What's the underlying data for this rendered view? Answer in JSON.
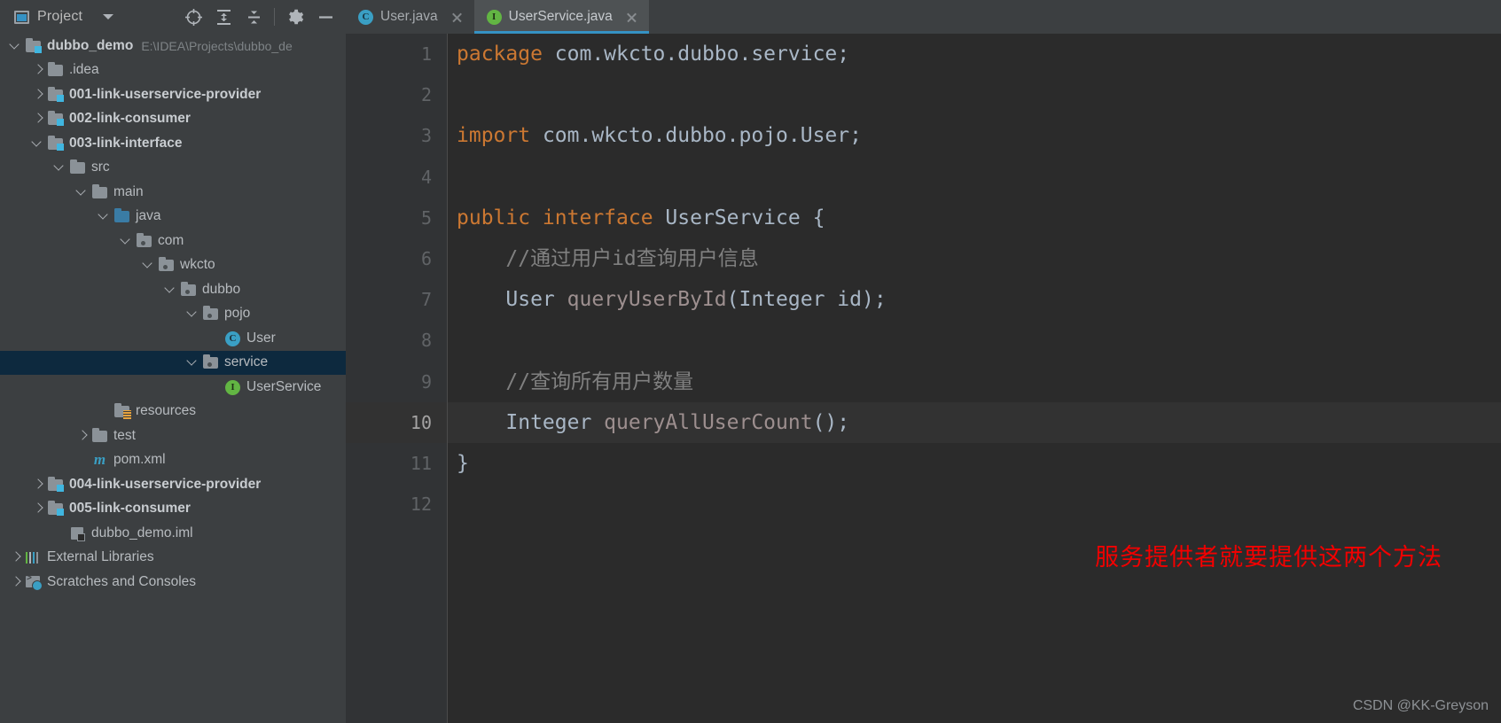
{
  "project_panel": {
    "title": "Project",
    "window_icon": "project-window-icon",
    "dropdown_icon": "chevron-down-icon",
    "toolbar_buttons": [
      {
        "name": "locate-icon",
        "label": "",
        "glyph": "crosshair"
      },
      {
        "name": "expand-all-icon",
        "label": "",
        "glyph": "expand-all"
      },
      {
        "name": "collapse-all-icon",
        "label": "",
        "glyph": "collapse-all"
      },
      {
        "name": "settings-gear-icon",
        "label": "",
        "glyph": "gear"
      },
      {
        "name": "hide-panel-icon",
        "label": "",
        "glyph": "minus"
      }
    ]
  },
  "tree": [
    {
      "indent": 0,
      "arrow": "down",
      "icon": "module-folder",
      "label": "dubbo_demo",
      "bold": true,
      "path": "E:\\IDEA\\Projects\\dubbo_de",
      "selected": false
    },
    {
      "indent": 1,
      "arrow": "right",
      "icon": "folder",
      "label": ".idea",
      "bold": false,
      "selected": false
    },
    {
      "indent": 1,
      "arrow": "right",
      "icon": "module-folder",
      "label": "001-link-userservice-provider",
      "bold": true,
      "selected": false
    },
    {
      "indent": 1,
      "arrow": "right",
      "icon": "module-folder",
      "label": "002-link-consumer",
      "bold": true,
      "selected": false
    },
    {
      "indent": 1,
      "arrow": "down",
      "icon": "module-folder",
      "label": "003-link-interface",
      "bold": true,
      "selected": false
    },
    {
      "indent": 2,
      "arrow": "down",
      "icon": "folder",
      "label": "src",
      "bold": false,
      "selected": false
    },
    {
      "indent": 3,
      "arrow": "down",
      "icon": "folder",
      "label": "main",
      "bold": false,
      "selected": false
    },
    {
      "indent": 4,
      "arrow": "down",
      "icon": "source-folder",
      "label": "java",
      "bold": false,
      "selected": false
    },
    {
      "indent": 5,
      "arrow": "down",
      "icon": "package",
      "label": "com",
      "bold": false,
      "selected": false
    },
    {
      "indent": 6,
      "arrow": "down",
      "icon": "package",
      "label": "wkcto",
      "bold": false,
      "selected": false
    },
    {
      "indent": 7,
      "arrow": "down",
      "icon": "package",
      "label": "dubbo",
      "bold": false,
      "selected": false
    },
    {
      "indent": 8,
      "arrow": "down",
      "icon": "package",
      "label": "pojo",
      "bold": false,
      "selected": false
    },
    {
      "indent": 9,
      "arrow": "none",
      "icon": "class",
      "label": "User",
      "bold": false,
      "selected": false
    },
    {
      "indent": 8,
      "arrow": "down",
      "icon": "package",
      "label": "service",
      "bold": false,
      "selected": true
    },
    {
      "indent": 9,
      "arrow": "none",
      "icon": "interface",
      "label": "UserService",
      "bold": false,
      "selected": false
    },
    {
      "indent": 4,
      "arrow": "none",
      "icon": "resource-folder",
      "label": "resources",
      "bold": false,
      "selected": false
    },
    {
      "indent": 3,
      "arrow": "right",
      "icon": "folder",
      "label": "test",
      "bold": false,
      "selected": false
    },
    {
      "indent": 3,
      "arrow": "none",
      "icon": "maven",
      "label": "pom.xml",
      "bold": false,
      "selected": false
    },
    {
      "indent": 1,
      "arrow": "right",
      "icon": "module-folder",
      "label": "004-link-userservice-provider",
      "bold": true,
      "selected": false
    },
    {
      "indent": 1,
      "arrow": "right",
      "icon": "module-folder",
      "label": "005-link-consumer",
      "bold": true,
      "selected": false
    },
    {
      "indent": 2,
      "arrow": "none",
      "icon": "iml",
      "label": "dubbo_demo.iml",
      "bold": false,
      "selected": false
    },
    {
      "indent": 0,
      "arrow": "right",
      "icon": "libraries",
      "label": "External Libraries",
      "bold": false,
      "selected": false
    },
    {
      "indent": 0,
      "arrow": "right",
      "icon": "scratches",
      "label": "Scratches and Consoles",
      "bold": false,
      "selected": false
    }
  ],
  "tabs": [
    {
      "label": "User.java",
      "icon": "class-icon",
      "icon_letter": "C",
      "active": false,
      "closable": true
    },
    {
      "label": "UserService.java",
      "icon": "interface-icon",
      "icon_letter": "I",
      "active": true,
      "closable": true
    }
  ],
  "editor": {
    "gutter_numbers": [
      "1",
      "2",
      "3",
      "4",
      "5",
      "6",
      "7",
      "8",
      "9",
      "10",
      "11",
      "12"
    ],
    "current_line": 10,
    "lines": [
      {
        "n": 1,
        "tokens": [
          {
            "t": "package",
            "c": "kw"
          },
          {
            "t": " com.wkcto.dubbo.service;",
            "c": "id"
          }
        ]
      },
      {
        "n": 2,
        "tokens": []
      },
      {
        "n": 3,
        "tokens": [
          {
            "t": "import",
            "c": "kw"
          },
          {
            "t": " com.wkcto.dubbo.pojo.User;",
            "c": "id"
          }
        ]
      },
      {
        "n": 4,
        "tokens": []
      },
      {
        "n": 5,
        "tokens": [
          {
            "t": "public interface",
            "c": "kw"
          },
          {
            "t": " UserService ",
            "c": "id"
          },
          {
            "t": "{",
            "c": "punc"
          }
        ]
      },
      {
        "n": 6,
        "tokens": [
          {
            "t": "    //通过用户id查询用户信息",
            "c": "cm"
          }
        ]
      },
      {
        "n": 7,
        "tokens": [
          {
            "t": "    User ",
            "c": "id"
          },
          {
            "t": "queryUserById",
            "c": "mth"
          },
          {
            "t": "(",
            "c": "punc"
          },
          {
            "t": "Integer id",
            "c": "id"
          },
          {
            "t": ");",
            "c": "punc"
          }
        ]
      },
      {
        "n": 8,
        "tokens": []
      },
      {
        "n": 9,
        "tokens": [
          {
            "t": "    //查询所有用户数量",
            "c": "cm"
          }
        ]
      },
      {
        "n": 10,
        "tokens": [
          {
            "t": "    Integer ",
            "c": "id"
          },
          {
            "t": "queryAllUserCount",
            "c": "mth"
          },
          {
            "t": "();",
            "c": "punc"
          }
        ]
      },
      {
        "n": 11,
        "tokens": [
          {
            "t": "}",
            "c": "punc"
          }
        ]
      },
      {
        "n": 12,
        "tokens": []
      }
    ]
  },
  "annotation": {
    "text": "服务提供者就要提供这两个方法",
    "color": "#f20000"
  },
  "watermark": {
    "text": "CSDN @KK-Greyson"
  },
  "colors": {
    "panel_bg": "#3c3f41",
    "editor_bg": "#2b2b2b",
    "gutter_bg": "#313335",
    "selection_bg": "#0d293e",
    "tab_active_bg": "#4e5254",
    "tab_underline": "#3592c4",
    "keyword": "#cc7832",
    "comment": "#808080",
    "identifier": "#a9b7c6",
    "current_line_bg": "#323232"
  }
}
